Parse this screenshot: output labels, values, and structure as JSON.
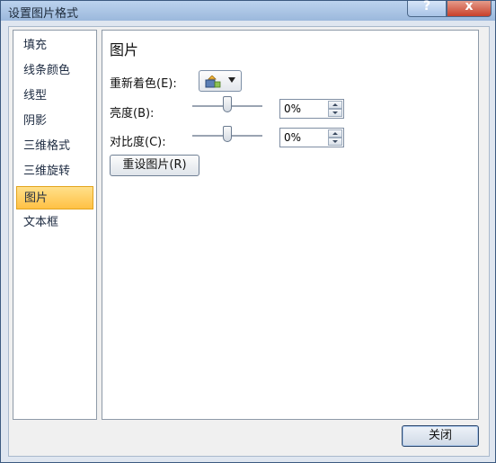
{
  "window": {
    "title": "设置图片格式",
    "help_symbol": "?",
    "close_symbol": "x"
  },
  "nav": {
    "items": [
      {
        "label": "填充"
      },
      {
        "label": "线条颜色"
      },
      {
        "label": "线型"
      },
      {
        "label": "阴影"
      },
      {
        "label": "三维格式"
      },
      {
        "label": "三维旋转"
      },
      {
        "label": "图片"
      },
      {
        "label": "文本框"
      }
    ],
    "selected": "图片"
  },
  "panel": {
    "title": "图片",
    "recolor_label": "重新着色(E):",
    "brightness_label": "亮度(B):",
    "brightness_value": "0%",
    "brightness_level": 0,
    "contrast_label": "对比度(C):",
    "contrast_value": "0%",
    "contrast_level": 0,
    "reset_label": "重设图片(R)"
  },
  "footer": {
    "close_label": "关闭"
  },
  "colors": {
    "selected_bg": "#ffc145",
    "title_bar": "#9bb8dc",
    "close_button": "#c8402a"
  }
}
